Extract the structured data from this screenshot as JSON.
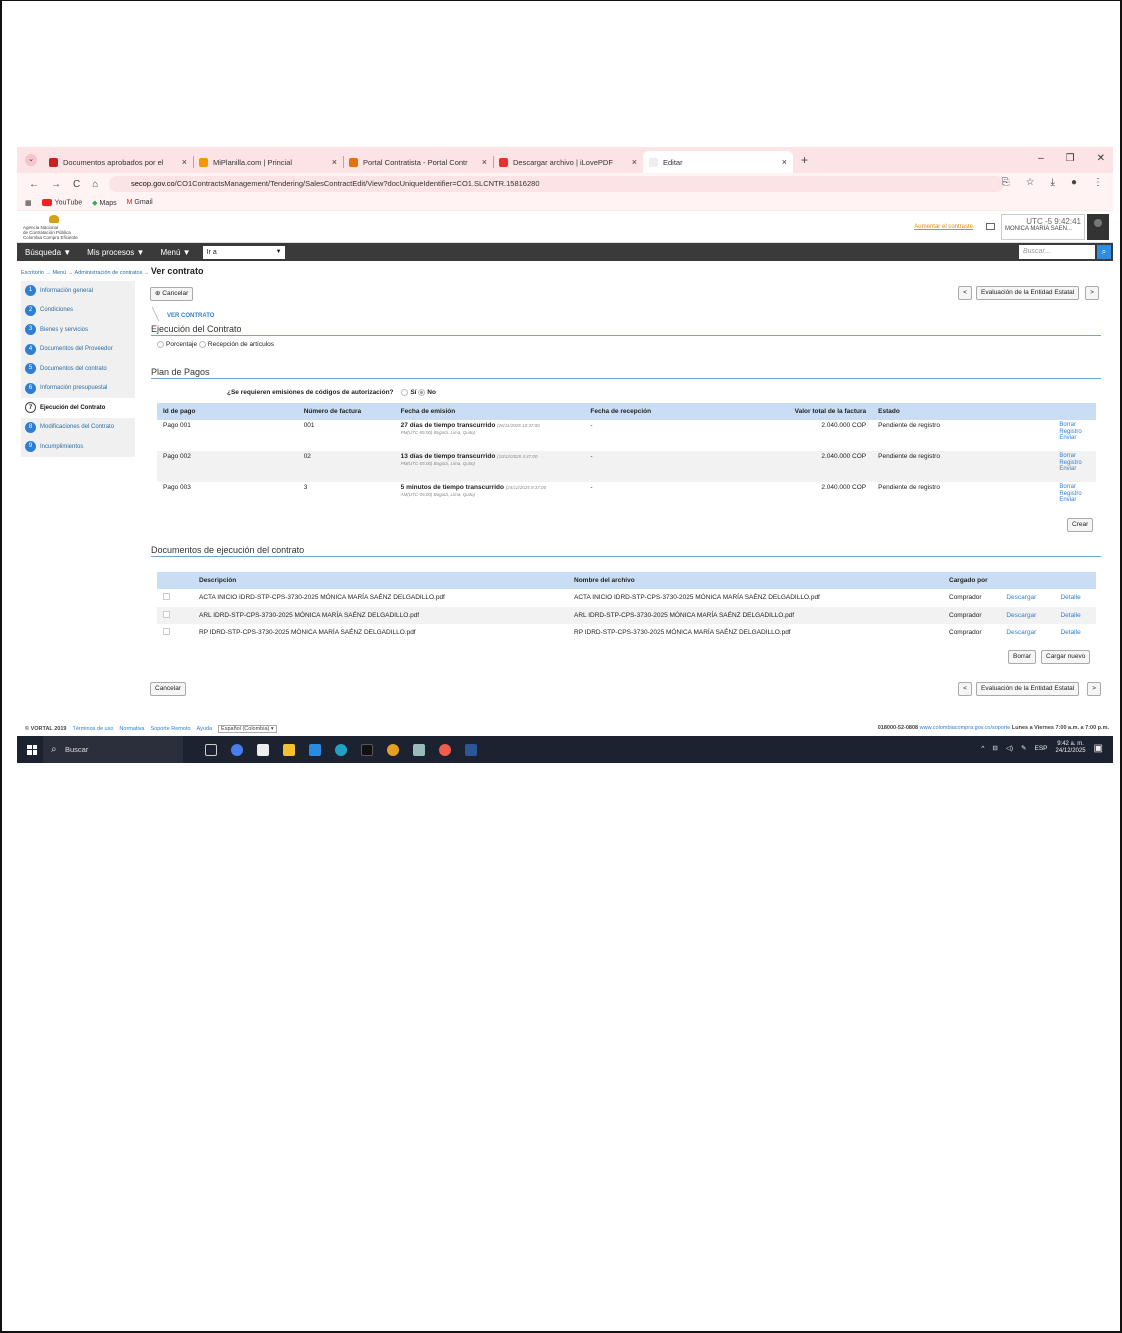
{
  "browser": {
    "tabs": [
      {
        "title": "Documentos aprobados por el",
        "color": "#c5221f"
      },
      {
        "title": "MiPlanilla.com | Princial",
        "color": "#f29900"
      },
      {
        "title": "Portal Contratista - Portal Contr",
        "color": "#e37400"
      },
      {
        "title": "Descargar archivo | iLovePDF",
        "color": "#e5322d"
      },
      {
        "title": "Editar",
        "color": "#ffffff",
        "active": true
      }
    ],
    "url_host": "secop.gov.co",
    "url_path": "/CO1ContractsManagement/Tendering/SalesContractEdit/View?docUniqueIdentifier=CO1.SLCNTR.15816280",
    "bookmarks": [
      "YouTube",
      "Maps",
      "Gmail"
    ]
  },
  "header": {
    "logo_lines": [
      "Agencia Nacional",
      "de Contratación Pública",
      "Colombia Compra Eficiente"
    ],
    "aumentar": "Aumentar el contraste",
    "utc": "UTC -5",
    "time": "9:42:41",
    "user": "MONICA MARIA SAEN..."
  },
  "nav": {
    "busqueda": "Búsqueda ▼",
    "procesos": "Mis procesos ▼",
    "menu": "Menú ▼",
    "ira": "Ir a",
    "buscar_placeholder": "Buscar..."
  },
  "breadcrumb": {
    "path": "Escritorio → Menú → Administración de contratos →",
    "current": "Ver contrato"
  },
  "sidebar": [
    {
      "n": "1",
      "label": "Información general"
    },
    {
      "n": "2",
      "label": "Condiciones"
    },
    {
      "n": "3",
      "label": "Bienes y servicios"
    },
    {
      "n": "4",
      "label": "Documentos del Proveedor"
    },
    {
      "n": "5",
      "label": "Documentos del contrato"
    },
    {
      "n": "6",
      "label": "Información presupuestal"
    },
    {
      "n": "7",
      "label": "Ejecución del Contrato",
      "active": true
    },
    {
      "n": "8",
      "label": "Modificaciones del Contrato"
    },
    {
      "n": "9",
      "label": "Incumplimientos"
    }
  ],
  "main": {
    "cancelar_top": "Cancelar",
    "evaluacion": "Evaluación de la Entidad Estatal",
    "prev": "<",
    "next": ">",
    "ver_contrato": "VER CONTRATO",
    "ejecucion_title": "Ejecución del Contrato",
    "opt_porcentaje": "Porcentaje",
    "opt_recepcion": "Recepción de artículos",
    "plan_title": "Plan de Pagos",
    "codigos_q": "¿Se requieren emisiones de códigos de autorización?",
    "si": "Sí",
    "no": "No",
    "pagos_headers": [
      "Id de pago",
      "Número de factura",
      "Fecha de emisión",
      "Fecha de recepción",
      "Valor total de la factura",
      "Estado"
    ],
    "pagos": [
      {
        "id": "Pago 001",
        "factura": "001",
        "fecha": "27 días de tiempo transcurrido",
        "fecha_det": "(26/11/2025 10:37:00",
        "fecha_tz": "PM(UTC-05:00) Bogotá, Lima, Quito)",
        "recepcion": "-",
        "valor": "2.040.000 COP",
        "estado": "Pendiente de registro"
      },
      {
        "id": "Pago 002",
        "factura": "02",
        "fecha": "13 días de tiempo transcurrido",
        "fecha_det": "(10/12/2025 4:47:00",
        "fecha_tz": "PM(UTC-05:00) Bogotá, Lima, Quito)",
        "recepcion": "-",
        "valor": "2.040.000 COP",
        "estado": "Pendiente de registro"
      },
      {
        "id": "Pago 003",
        "factura": "3",
        "fecha": "5 minutos de tiempo transcurrido",
        "fecha_det": "(24/12/2025 9:37:00",
        "fecha_tz": "AM(UTC-05:00) Bogotá, Lima, Quito)",
        "recepcion": "-",
        "valor": "2.040.000 COP",
        "estado": "Pendiente de registro"
      }
    ],
    "row_links": [
      "Borrar",
      "Registro",
      "Enviar"
    ],
    "crear": "Crear",
    "docs_title": "Documentos de ejecución del contrato",
    "docs_headers": [
      "Descripción",
      "Nombre del archivo",
      "Cargado por"
    ],
    "docs": [
      {
        "desc": "ACTA INICIO IDRD-STP-CPS-3730-2025 MÓNICA MARÍA SAÉNZ DELGADILLO.pdf",
        "file": "ACTA INICIO IDRD-STP-CPS-3730-2025 MÓNICA MARÍA SAÉNZ DELGADILLO.pdf",
        "by": "Comprador"
      },
      {
        "desc": "ARL IDRD-STP-CPS-3730-2025 MÓNICA MARÍA SAÉNZ DELGADILLO.pdf",
        "file": "ARL IDRD-STP-CPS-3730-2025 MÓNICA MARÍA SAÉNZ DELGADILLO.pdf",
        "by": "Comprador"
      },
      {
        "desc": "RP IDRD-STP-CPS-3730-2025 MÓNICA MARÍA SAÉNZ DELGADILLO.pdf",
        "file": "RP IDRD-STP-CPS-3730-2025 MÓNICA MARÍA SAÉNZ DELGADILLO.pdf",
        "by": "Comprador"
      }
    ],
    "descargar": "Descargar",
    "detalle": "Detalle",
    "borrar": "Borrar",
    "cargar_nuevo": "Cargar nuevo",
    "cancelar_bottom": "Cancelar"
  },
  "footer": {
    "copyright": "© VORTAL 2019",
    "terminos": "Términos de uso",
    "normativa": "Normativa",
    "soporte": "Soporte Remoto",
    "ayuda": "Ayuda",
    "idioma": "Español (Colombia)",
    "phone": "018000-52-0808",
    "url": "www.colombiacompra.gov.co/soporte",
    "horario": "Lunes a Viernes 7:00 a.m. a 7:00 p.m."
  },
  "taskbar": {
    "search": "Buscar",
    "lang": "ESP",
    "time": "9:42 a. m.",
    "date": "24/12/2025"
  }
}
